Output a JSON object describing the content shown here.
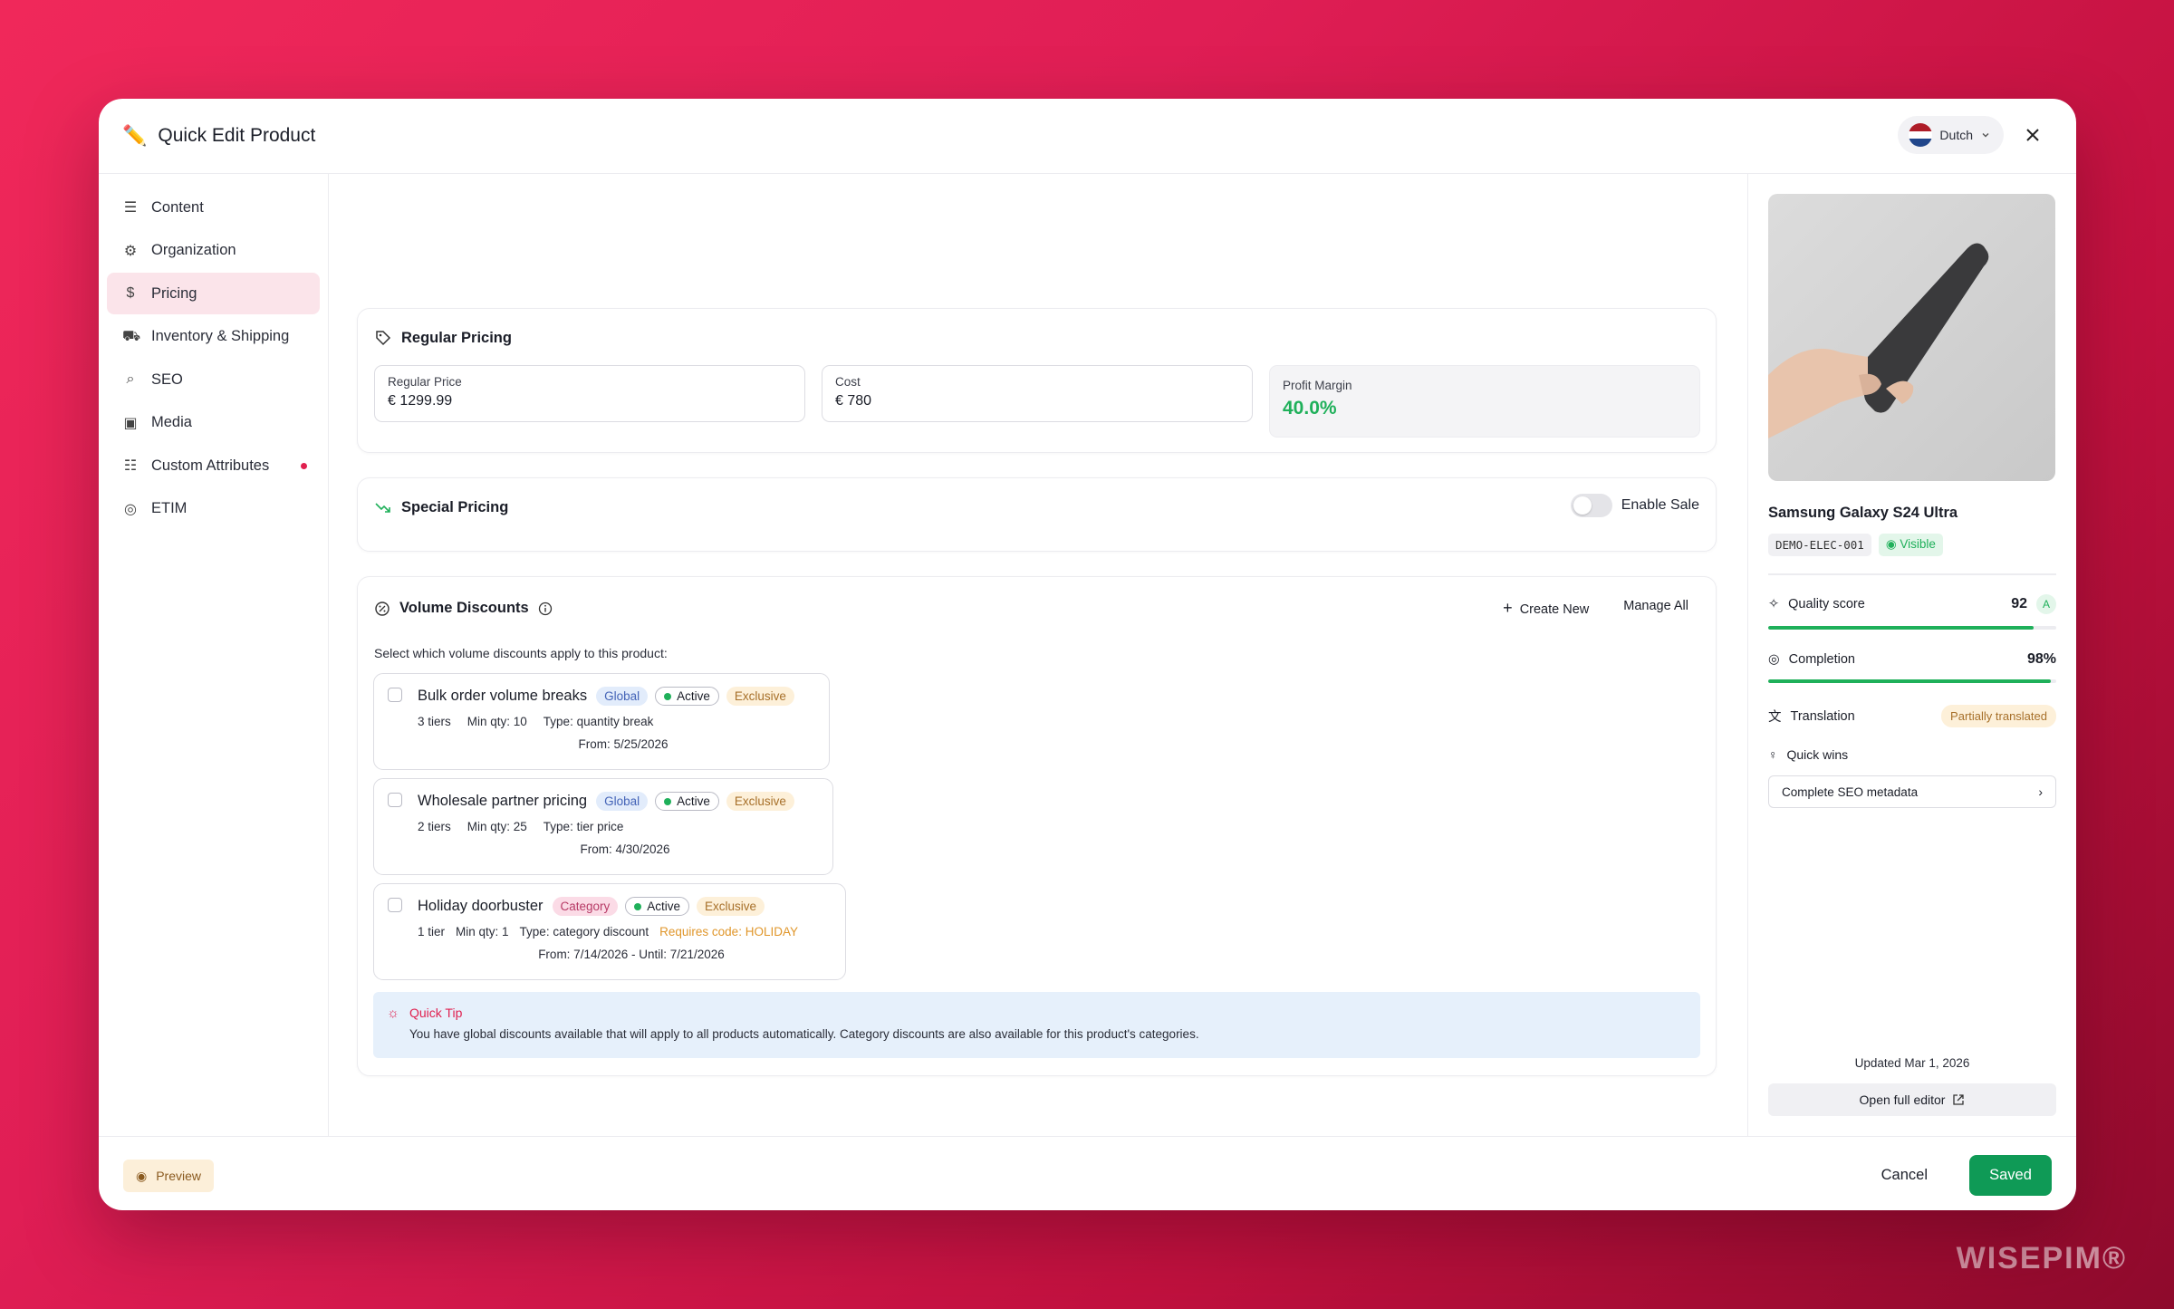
{
  "window": {
    "title": "Quick Edit Product"
  },
  "header": {
    "language": "Dutch"
  },
  "sidebar": {
    "items": [
      {
        "label": "Content",
        "icon": "lines-icon"
      },
      {
        "label": "Organization",
        "icon": "gear-icon"
      },
      {
        "label": "Pricing",
        "icon": "dollar-icon",
        "active": true
      },
      {
        "label": "Inventory & Shipping",
        "icon": "truck-icon"
      },
      {
        "label": "SEO",
        "icon": "search-icon"
      },
      {
        "label": "Media",
        "icon": "image-icon"
      },
      {
        "label": "Custom Attributes",
        "icon": "sliders-icon",
        "dot": true
      },
      {
        "label": "ETIM",
        "icon": "check-circle-icon"
      }
    ]
  },
  "regular_pricing": {
    "title": "Regular Pricing",
    "price_label": "Regular Price",
    "price_value": "€  1299.99",
    "cost_label": "Cost",
    "cost_value": "€  780",
    "margin_label": "Profit Margin",
    "margin_value": "40.0%"
  },
  "special_pricing": {
    "title": "Special Pricing",
    "toggle_label": "Enable Sale"
  },
  "volume_discounts": {
    "title": "Volume Discounts",
    "create_new": "Create New",
    "manage_all": "Manage All",
    "instruction": "Select which volume discounts apply to this product:",
    "items": [
      {
        "name": "Bulk order volume breaks",
        "scope": "Global",
        "status": "Active",
        "mode": "Exclusive",
        "tiers": "3 tiers",
        "min_qty": "Min qty: 10",
        "type": "Type: quantity break",
        "code": "",
        "dates": "From: 5/25/2026"
      },
      {
        "name": "Wholesale partner pricing",
        "scope": "Global",
        "status": "Active",
        "mode": "Exclusive",
        "tiers": "2 tiers",
        "min_qty": "Min qty: 25",
        "type": "Type: tier price",
        "code": "",
        "dates": "From: 4/30/2026"
      },
      {
        "name": "Holiday doorbuster",
        "scope": "Category",
        "status": "Active",
        "mode": "Exclusive",
        "tiers": "1 tier",
        "min_qty": "Min qty: 1",
        "type": "Type: category discount",
        "code": "Requires code: HOLIDAY",
        "dates": "From: 7/14/2026 - Until: 7/21/2026"
      }
    ],
    "tip_title": "Quick Tip",
    "tip_text": "You have global discounts available that will apply to all products automatically. Category discounts are also available for this product's categories."
  },
  "product": {
    "name": "Samsung Galaxy S24 Ultra",
    "sku": "DEMO-ELEC-001",
    "visibility": "Visible",
    "quality_label": "Quality score",
    "quality_value": "92",
    "quality_grade": "A",
    "quality_fraction": 0.92,
    "completion_label": "Completion",
    "completion_value": "98%",
    "completion_fraction": 0.98,
    "translation_label": "Translation",
    "translation_status": "Partially translated",
    "quick_wins_label": "Quick wins",
    "quick_win_item": "Complete SEO metadata",
    "updated": "Updated Mar 1, 2026",
    "open_editor": "Open full editor"
  },
  "footer": {
    "preview": "Preview",
    "cancel": "Cancel",
    "saved": "Saved"
  },
  "brand": "WISEPIM®",
  "colors": {
    "accent": "#e0204f",
    "success": "#1fb05a",
    "saved_button": "#0f9a56"
  }
}
